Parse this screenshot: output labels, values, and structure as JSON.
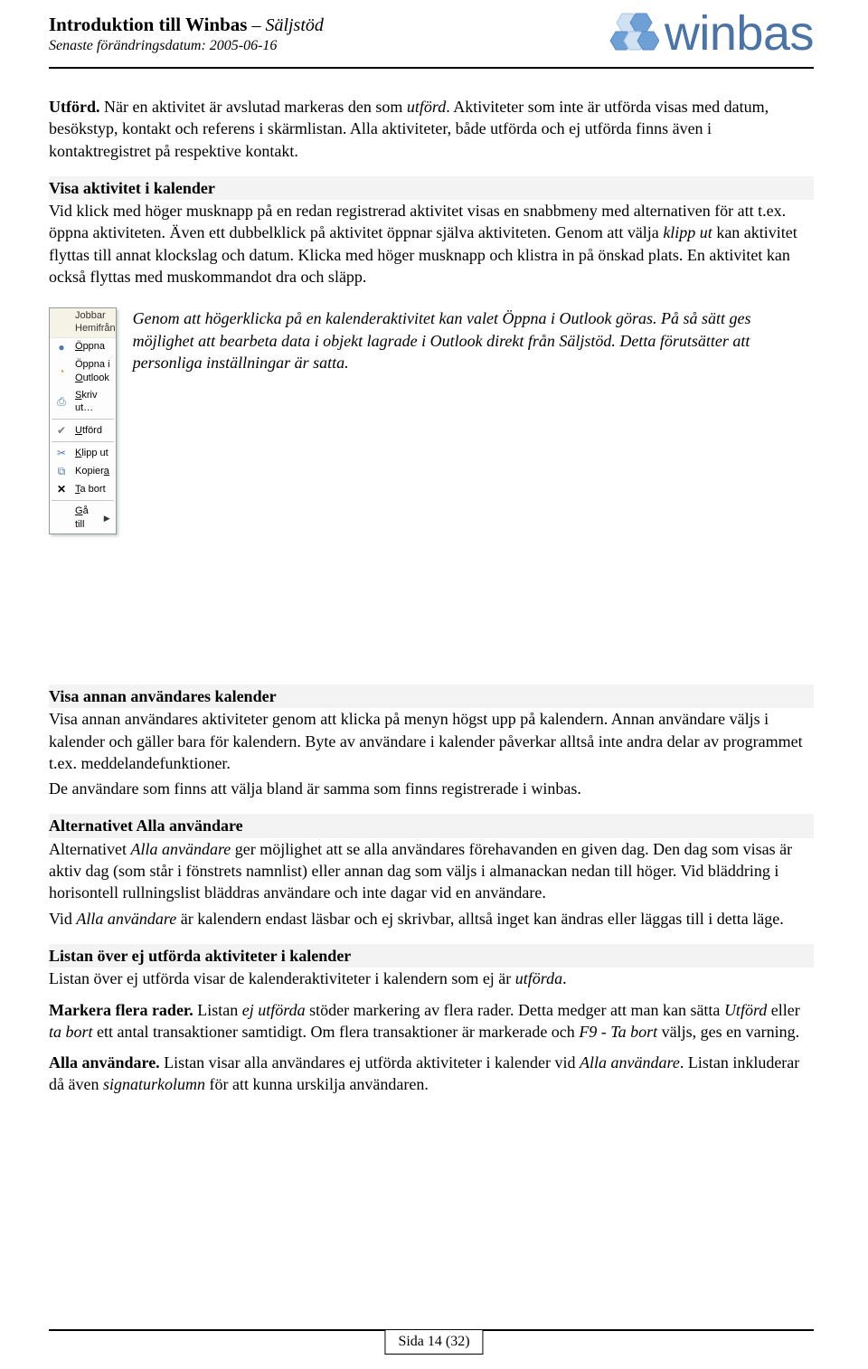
{
  "header": {
    "title": "Introduktion till Winbas",
    "subtitle": " – Säljstöd",
    "date_label": "Senaste förändringsdatum: 2005-06-16",
    "logo_text": "winbas"
  },
  "p_utford": "Utförd. När en aktivitet är avslutad markeras den som utförd. Aktiviteter som inte är utförda visas med datum, besökstyp, kontakt och referens i skärmlistan. Alla aktiviteter, både utförda och ej utförda finns även i kontaktregistret på respektive kontakt.",
  "h_visa_kal": "Visa aktivitet i kalender",
  "p_visa_kal": "Vid klick med höger musknapp på en redan registrerad aktivitet visas en snabbmeny med alternativen för att t.ex. öppna aktiviteten. Även ett dubbelklick på aktivitet öppnar själva aktiviteten. Genom att välja klipp ut kan aktivitet flyttas till annat klockslag och datum. Klicka med höger musknapp och klistra in på önskad plats. En aktivitet kan också flyttas med muskommandot dra och släpp.",
  "menu": {
    "hdr1": "Jobbar",
    "hdr2": "Hemifrån",
    "open": "Öppna",
    "open_outlook": "Öppna i Outlook",
    "print": "Skriv ut…",
    "done": "Utförd",
    "cut": "Klipp ut",
    "copy": "Kopiera",
    "delete": "Ta bort",
    "goto": "Gå till"
  },
  "p_outlook": "Genom att högerklicka på en kalenderaktivitet kan valet Öppna i Outlook göras. På så sätt ges möjlighet att bearbeta data i objekt lagrade i Outlook direkt från Säljstöd. Detta förutsätter att personliga inställningar är satta.",
  "h_visa_annan": "Visa annan användares kalender",
  "p_visa_annan1": "Visa annan användares aktiviteter genom att klicka på menyn högst upp på kalendern. Annan användare väljs i kalender och gäller bara för kalendern. Byte av användare i kalender påverkar alltså inte andra delar av programmet t.ex. meddelandefunktioner.",
  "p_visa_annan2": "De användare som finns att välja bland är samma som finns registrerade i winbas.",
  "h_alla": "Alternativet Alla användare",
  "p_alla1": "Alternativet Alla användare ger möjlighet att se alla användares förehavanden en given dag. Den dag som visas är aktiv dag (som står i fönstrets namnlist) eller annan dag som väljs i almanackan nedan till höger. Vid bläddring i horisontell rullningslist bläddras användare och inte dagar vid en användare.",
  "p_alla2": "Vid Alla användare är kalendern endast läsbar och ej skrivbar, alltså inget kan ändras eller läggas till i detta läge.",
  "h_lista": "Listan över ej utförda aktiviteter i kalender",
  "p_lista": "Listan över ej utförda visar de kalenderaktiviteter i kalendern som ej är utförda.",
  "p_markera": "Markera flera rader. Listan ej utförda stöder markering av flera rader. Detta medger att man kan sätta Utförd eller ta bort ett antal transaktioner samtidigt. Om flera transaktioner är markerade och F9 - Ta bort väljs, ges en varning.",
  "p_alla_anv": "Alla användare. Listan visar alla användares ej utförda aktiviteter i kalender vid Alla användare. Listan inkluderar då även signaturkolumn för att kunna urskilja användaren.",
  "footer": "Sida 14 (32)"
}
